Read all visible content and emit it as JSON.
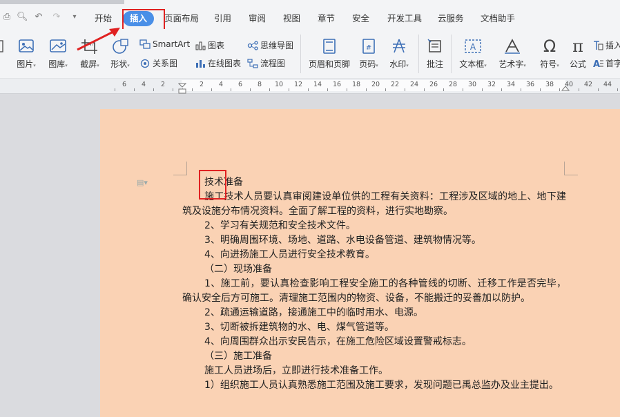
{
  "menubar": {
    "tabs": [
      "开始",
      "插入",
      "页面布局",
      "引用",
      "审阅",
      "视图",
      "章节",
      "安全",
      "开发工具",
      "云服务",
      "文档助手"
    ],
    "active_tab": "插入"
  },
  "ribbon": {
    "picture": "图片",
    "gallery": "图库",
    "screenshot": "截屏",
    "shape": "形状",
    "smartart": "SmartArt",
    "relation": "关系图",
    "chart": "图表",
    "online_chart": "在线图表",
    "mindmap": "思维导图",
    "flowchart": "流程图",
    "header_footer": "页眉和页脚",
    "page_number": "页码",
    "watermark": "水印",
    "comment": "批注",
    "textbox": "文本框",
    "wordart": "艺术字",
    "symbol": "符号",
    "formula": "公式",
    "insert_more": "插入",
    "dropcap": "首字"
  },
  "ruler": {
    "labels": [
      "6",
      "4",
      "2",
      "2",
      "4",
      "6",
      "8",
      "10",
      "12",
      "14",
      "16",
      "18",
      "20",
      "22",
      "24",
      "26",
      "28",
      "30",
      "32",
      "34",
      "36",
      "38",
      "40",
      "42",
      "44"
    ]
  },
  "document": {
    "heading_prefix": "技术",
    "heading_suffix": "准备",
    "lines": [
      "施工技术人员要认真审阅建设单位供的工程有关资料：工程涉及区域的地上、地下建筑及设施分布情况资料。全面了解工程的资料，进行实地勘察。",
      "2、学习有关规范和安全技术文件。",
      "3、明确周围环境、场地、道路、水电设备管道、建筑物情况等。",
      "4、向进扬施工人员进行安全技术教育。",
      "（二）现场准备",
      "1、施工前，要认真检查影响工程安全施工的各种管线的切断、迁移工作是否完毕，确认安全后方可施工。清理施工范围内的物资、设备，不能搬迁的妥善加以防护。",
      "2、疏通运输道路，接通施工中的临时用水、电源。",
      "3、切断被拆建筑物的水、电、煤气管道等。",
      "4、向周围群众出示安民告示，在施工危险区域设置警戒标志。",
      "（三）施工准备",
      "施工人员进场后，立即进行技术准备工作。",
      "1）组织施工人员认真熟悉施工范围及施工要求，发现问题已禹总监办及业主提出。"
    ]
  },
  "colors": {
    "page_bg": "#fad2b4",
    "active_tab": "#4a8fe7",
    "highlight_box": "#e02121"
  }
}
